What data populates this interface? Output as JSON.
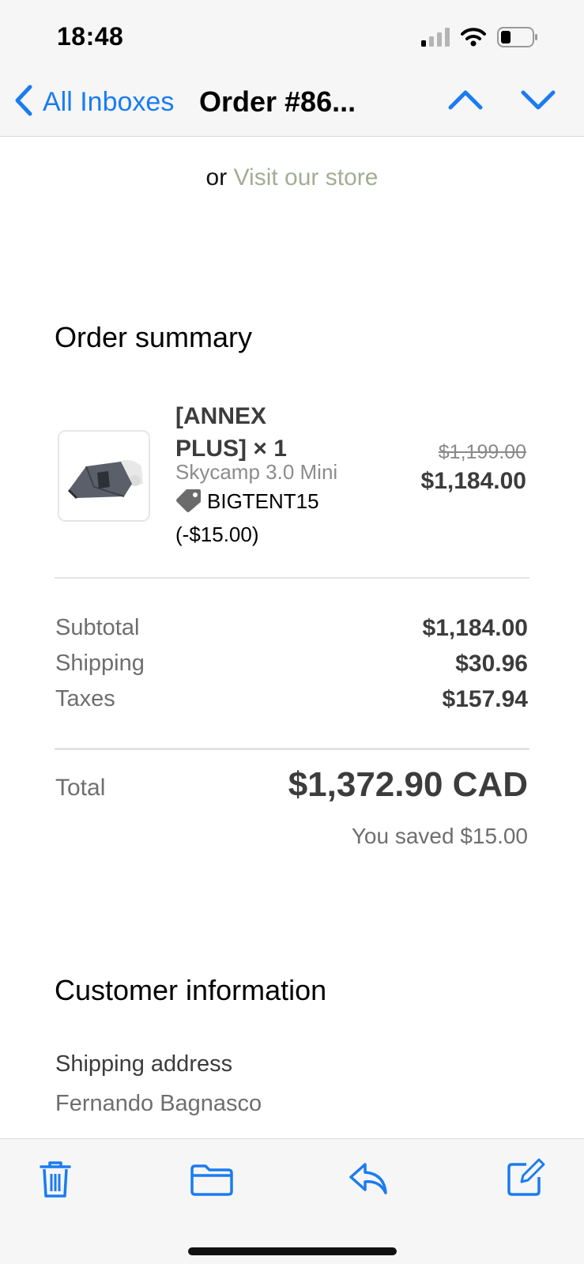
{
  "status_bar": {
    "time": "18:48"
  },
  "nav": {
    "back_label": "All Inboxes",
    "title": "Order #86..."
  },
  "store": {
    "prefix": "or",
    "link": "Visit our store"
  },
  "order_summary": {
    "heading": "Order summary",
    "item": {
      "name": "[ANNEX PLUS] × 1",
      "variant": "Skycamp 3.0 Mini",
      "discount": "BIGTENT15 (-$15.00)",
      "price_original": "$1,199.00",
      "price_final": "$1,184.00"
    },
    "rows": [
      {
        "label": "Subtotal",
        "value": "$1,184.00"
      },
      {
        "label": "Shipping",
        "value": "$30.96"
      },
      {
        "label": "Taxes",
        "value": "$157.94"
      }
    ],
    "total_label": "Total",
    "total_value": "$1,372.90 CAD",
    "saved": "You saved $15.00"
  },
  "customer": {
    "heading": "Customer information",
    "shipping_label": "Shipping address",
    "name": "Fernando Bagnasco"
  },
  "colors": {
    "accent": "#1a7cf0",
    "store_link": "#a3ad94",
    "text_dark": "#3c3c3c",
    "text_muted": "#6e6e6e"
  },
  "icons": {
    "signal": "cellular-signal-icon",
    "wifi": "wifi-icon",
    "battery": "battery-icon",
    "back": "chevron-left-icon",
    "up": "chevron-up-icon",
    "down": "chevron-down-icon",
    "tag": "tag-icon",
    "trash": "trash-icon",
    "folder": "folder-icon",
    "reply": "reply-icon",
    "compose": "compose-icon"
  }
}
